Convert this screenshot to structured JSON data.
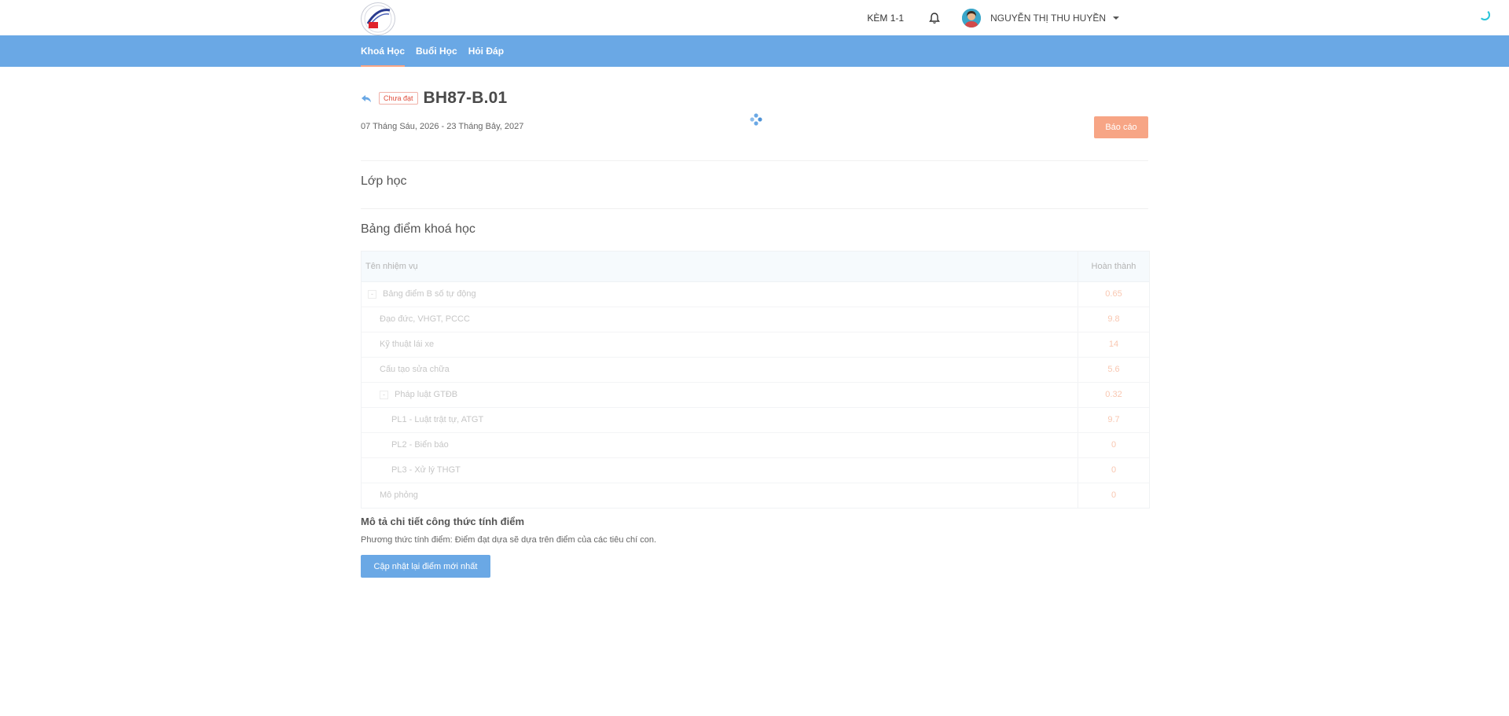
{
  "header": {
    "kem_label": "KÈM 1-1",
    "user_name": "NGUYỄN THỊ THU HUYỀN"
  },
  "nav": {
    "items": [
      {
        "label": "Khoá Học",
        "active": true
      },
      {
        "label": "Buổi Học",
        "active": false
      },
      {
        "label": "Hỏi Đáp",
        "active": false
      }
    ]
  },
  "course": {
    "status_badge": "Chưa đạt",
    "title": "BH87-B.01",
    "date_range": "07 Tháng Sáu, 2026 - 23 Tháng Bảy, 2027",
    "report_label": "Báo cáo"
  },
  "sections": {
    "class_title": "Lớp học",
    "gradebook_title": "Bảng điểm khoá học"
  },
  "gradebook": {
    "columns": [
      "Tên nhiệm vụ",
      "Hoàn thành"
    ],
    "rows": [
      {
        "name": "Bảng điểm B số tự động",
        "value": "0.65",
        "level": 0,
        "expander": "-"
      },
      {
        "name": "Đạo đức, VHGT, PCCC",
        "value": "9.8",
        "level": 1,
        "expander": ""
      },
      {
        "name": "Kỹ thuật lái xe",
        "value": "14",
        "level": 1,
        "expander": ""
      },
      {
        "name": "Cấu tạo sửa chữa",
        "value": "5.6",
        "level": 1,
        "expander": ""
      },
      {
        "name": "Pháp luật GTĐB",
        "value": "0.32",
        "level": 1,
        "expander": "-"
      },
      {
        "name": "PL1 - Luật trật tự, ATGT",
        "value": "9.7",
        "level": 2,
        "expander": ""
      },
      {
        "name": "PL2 - Biển báo",
        "value": "0",
        "level": 2,
        "expander": ""
      },
      {
        "name": "PL3 - Xử lý THGT",
        "value": "0",
        "level": 2,
        "expander": ""
      },
      {
        "name": "Mô phỏng",
        "value": "0",
        "level": 1,
        "expander": ""
      }
    ]
  },
  "formula": {
    "title": "Mô tả chi tiết công thức tính điểm",
    "text": "Phương thức tính điểm: Điểm đạt dựa sẽ dựa trên điểm của các tiêu chí con.",
    "update_label": "Cập nhật lại điểm mới nhất"
  },
  "colors": {
    "nav_bg": "#6aa8e5",
    "accent_orange": "#f7a585",
    "progress": "#29c4d9",
    "badge_red": "#e0503e"
  },
  "icons": [
    "logo",
    "bell-icon",
    "avatar",
    "chevron-down-icon",
    "back-arrow-icon",
    "loading-spinner-icon",
    "expander-minus-icon"
  ]
}
